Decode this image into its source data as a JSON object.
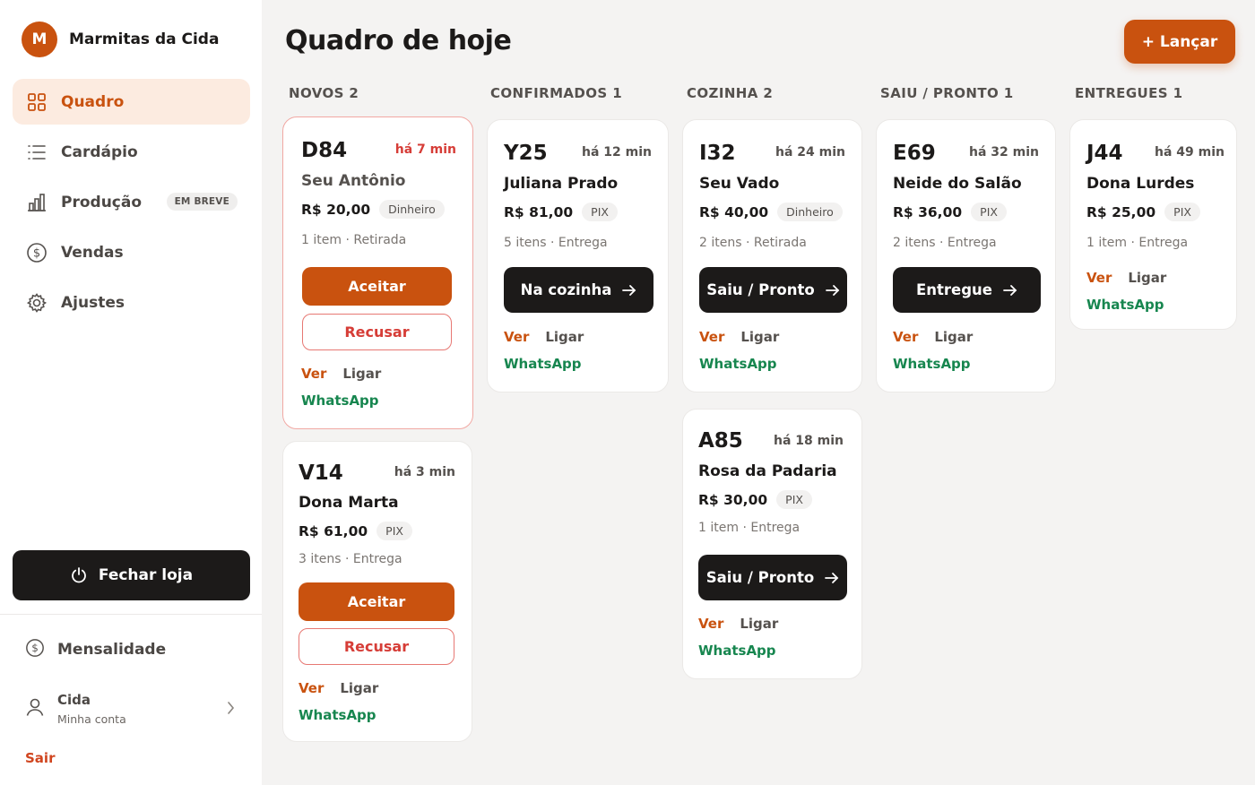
{
  "brand": {
    "initial": "M",
    "name": "Marmitas da Cida"
  },
  "nav": [
    {
      "label": "Quadro",
      "icon": "grid-icon",
      "active": true
    },
    {
      "label": "Cardápio",
      "icon": "list-icon"
    },
    {
      "label": "Produção",
      "icon": "bar-chart-icon",
      "badge": "EM BREVE"
    },
    {
      "label": "Vendas",
      "icon": "dollar-circle-icon"
    },
    {
      "label": "Ajustes",
      "icon": "gear-icon"
    }
  ],
  "close_store": {
    "label": "Fechar loja",
    "icon": "power-icon"
  },
  "subscription": {
    "label": "Mensalidade",
    "icon": "dollar-circle-icon"
  },
  "account": {
    "name": "Cida",
    "subtitle": "Minha conta",
    "icon": "user-icon"
  },
  "logout": "Sair",
  "page": {
    "title": "Quadro de hoje",
    "launch_label": "+ Lançar"
  },
  "columns": [
    {
      "label": "NOVOS 2"
    },
    {
      "label": "CONFIRMADOS 1"
    },
    {
      "label": "COZINHA 2"
    },
    {
      "label": "SAIU / PRONTO 1"
    },
    {
      "label": "ENTREGUES 1"
    }
  ],
  "actions": {
    "accept": "Aceitar",
    "refuse": "Recusar",
    "view": "Ver",
    "call": "Ligar",
    "whatsapp": "WhatsApp"
  },
  "orders": {
    "d84": {
      "code": "D84",
      "time": "há 7 min",
      "customer": "Seu Antônio",
      "price": "R$ 20,00",
      "payment": "Dinheiro",
      "items": "1 item",
      "mode": "Retirada"
    },
    "v14": {
      "code": "V14",
      "time": "há 3 min",
      "customer": "Dona Marta",
      "price": "R$ 61,00",
      "payment": "PIX",
      "items": "3 itens",
      "mode": "Entrega"
    },
    "y25": {
      "code": "Y25",
      "time": "há 12 min",
      "customer": "Juliana Prado",
      "price": "R$ 81,00",
      "payment": "PIX",
      "items": "5 itens",
      "mode": "Entrega",
      "action": "Na cozinha"
    },
    "i32": {
      "code": "I32",
      "time": "há 24 min",
      "customer": "Seu Vado",
      "price": "R$ 40,00",
      "payment": "Dinheiro",
      "items": "2 itens",
      "mode": "Retirada",
      "action": "Saiu / Pronto"
    },
    "a85": {
      "code": "A85",
      "time": "há 18 min",
      "customer": "Rosa da Padaria",
      "price": "R$ 30,00",
      "payment": "PIX",
      "items": "1 item",
      "mode": "Entrega",
      "action": "Saiu / Pronto"
    },
    "e69": {
      "code": "E69",
      "time": "há 32 min",
      "customer": "Neide do Salão",
      "price": "R$ 36,00",
      "payment": "PIX",
      "items": "2 itens",
      "mode": "Entrega",
      "action": "Entregue"
    },
    "j44": {
      "code": "J44",
      "time": "há 49 min",
      "customer": "Dona Lurdes",
      "price": "R$ 25,00",
      "payment": "PIX",
      "items": "1 item",
      "mode": "Entrega"
    }
  },
  "meta_separator": "·",
  "colors": {
    "accent": "#c9520f",
    "dark": "#1c1a19",
    "danger": "#d63d37",
    "whatsapp": "#17864f"
  }
}
